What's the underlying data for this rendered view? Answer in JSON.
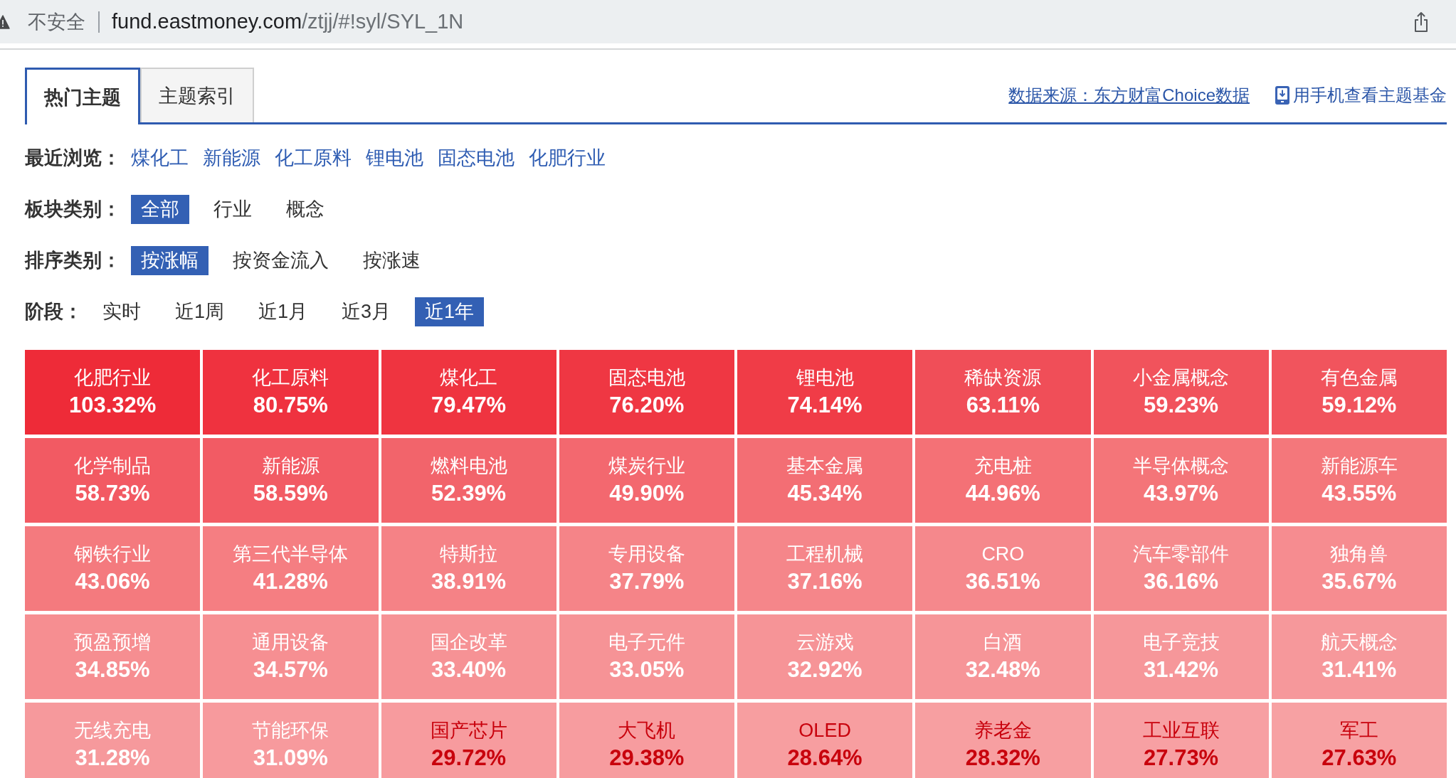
{
  "browser": {
    "security_label": "不安全",
    "url_host": "fund.eastmoney.com",
    "url_path": "/ztjj/#!syl/SYL_1N"
  },
  "tabs": [
    {
      "label": "热门主题",
      "selected": true
    },
    {
      "label": "主题索引",
      "selected": false
    }
  ],
  "header_links": [
    {
      "kind": "source",
      "label": "数据来源：东方财富Choice数据"
    },
    {
      "kind": "mobile",
      "label": "用手机查看主题基金"
    }
  ],
  "recent_views": {
    "label": "最近浏览：",
    "items": [
      "煤化工",
      "新能源",
      "化工原料",
      "锂电池",
      "固态电池",
      "化肥行业"
    ]
  },
  "filters": [
    {
      "label": "板块类别：",
      "options": [
        {
          "label": "全部",
          "selected": true
        },
        {
          "label": "行业",
          "selected": false
        },
        {
          "label": "概念",
          "selected": false
        }
      ]
    },
    {
      "label": "排序类别：",
      "options": [
        {
          "label": "按涨幅",
          "selected": true
        },
        {
          "label": "按资金流入",
          "selected": false
        },
        {
          "label": "按涨速",
          "selected": false
        }
      ]
    },
    {
      "label": "阶段：",
      "options": [
        {
          "label": "实时",
          "selected": false
        },
        {
          "label": "近1周",
          "selected": false
        },
        {
          "label": "近1月",
          "selected": false
        },
        {
          "label": "近3月",
          "selected": false
        },
        {
          "label": "近1年",
          "selected": true
        }
      ]
    }
  ],
  "tiles": [
    {
      "name": "化肥行业",
      "change": "103.32%",
      "color": "#ee2b38",
      "kind": "hot"
    },
    {
      "name": "化工原料",
      "change": "80.75%",
      "color": "#ef323f",
      "kind": "hot"
    },
    {
      "name": "煤化工",
      "change": "79.47%",
      "color": "#ef3440",
      "kind": "hot"
    },
    {
      "name": "固态电池",
      "change": "76.20%",
      "color": "#ef3743",
      "kind": "hot"
    },
    {
      "name": "锂电池",
      "change": "74.14%",
      "color": "#f03c47",
      "kind": "hot"
    },
    {
      "name": "稀缺资源",
      "change": "63.11%",
      "color": "#f04e58",
      "kind": "hot"
    },
    {
      "name": "小金属概念",
      "change": "59.23%",
      "color": "#f1535c",
      "kind": "hot"
    },
    {
      "name": "有色金属",
      "change": "59.12%",
      "color": "#f1545d",
      "kind": "hot"
    },
    {
      "name": "化学制品",
      "change": "58.73%",
      "color": "#f25a63",
      "kind": "hot"
    },
    {
      "name": "新能源",
      "change": "58.59%",
      "color": "#f25b64",
      "kind": "hot"
    },
    {
      "name": "燃料电池",
      "change": "52.39%",
      "color": "#f2646b",
      "kind": "hot"
    },
    {
      "name": "煤炭行业",
      "change": "49.90%",
      "color": "#f3686f",
      "kind": "hot"
    },
    {
      "name": "基本金属",
      "change": "45.34%",
      "color": "#f36e74",
      "kind": "hot"
    },
    {
      "name": "充电桩",
      "change": "44.96%",
      "color": "#f47176",
      "kind": "hot"
    },
    {
      "name": "半导体概念",
      "change": "43.97%",
      "color": "#f47579",
      "kind": "hot"
    },
    {
      "name": "新能源车",
      "change": "43.55%",
      "color": "#f4777b",
      "kind": "hot"
    },
    {
      "name": "钢铁行业",
      "change": "43.06%",
      "color": "#f47a7e",
      "kind": "hot"
    },
    {
      "name": "第三代半导体",
      "change": "41.28%",
      "color": "#f57e82",
      "kind": "hot"
    },
    {
      "name": "特斯拉",
      "change": "38.91%",
      "color": "#f58286",
      "kind": "hot"
    },
    {
      "name": "专用设备",
      "change": "37.79%",
      "color": "#f58488",
      "kind": "hot"
    },
    {
      "name": "工程机械",
      "change": "37.16%",
      "color": "#f5868a",
      "kind": "hot"
    },
    {
      "name": "CRO",
      "change": "36.51%",
      "color": "#f5888c",
      "kind": "hot"
    },
    {
      "name": "汽车零部件",
      "change": "36.16%",
      "color": "#f58a8d",
      "kind": "hot"
    },
    {
      "name": "独角兽",
      "change": "35.67%",
      "color": "#f68c90",
      "kind": "hot"
    },
    {
      "name": "预盈预增",
      "change": "34.85%",
      "color": "#f68e91",
      "kind": "hot"
    },
    {
      "name": "通用设备",
      "change": "34.57%",
      "color": "#f68f92",
      "kind": "hot"
    },
    {
      "name": "国企改革",
      "change": "33.40%",
      "color": "#f69295",
      "kind": "hot"
    },
    {
      "name": "电子元件",
      "change": "33.05%",
      "color": "#f69396",
      "kind": "hot"
    },
    {
      "name": "云游戏",
      "change": "32.92%",
      "color": "#f69497",
      "kind": "hot"
    },
    {
      "name": "白酒",
      "change": "32.48%",
      "color": "#f69598",
      "kind": "hot"
    },
    {
      "name": "电子竞技",
      "change": "31.42%",
      "color": "#f6979a",
      "kind": "hot"
    },
    {
      "name": "航天概念",
      "change": "31.41%",
      "color": "#f6989b",
      "kind": "hot"
    },
    {
      "name": "无线充电",
      "change": "31.28%",
      "color": "#f6999c",
      "kind": "hot"
    },
    {
      "name": "节能环保",
      "change": "31.09%",
      "color": "#f79a9d",
      "kind": "hot"
    },
    {
      "name": "国产芯片",
      "change": "29.72%",
      "color": "#f79b9e",
      "kind": "warm"
    },
    {
      "name": "大飞机",
      "change": "29.38%",
      "color": "#f79c9f",
      "kind": "warm"
    },
    {
      "name": "OLED",
      "change": "28.64%",
      "color": "#f79ea0",
      "kind": "warm"
    },
    {
      "name": "养老金",
      "change": "28.32%",
      "color": "#f79fa1",
      "kind": "warm"
    },
    {
      "name": "工业互联",
      "change": "27.73%",
      "color": "#f7a0a3",
      "kind": "warm"
    },
    {
      "name": "军工",
      "change": "27.63%",
      "color": "#f7a1a3",
      "kind": "warm"
    }
  ]
}
